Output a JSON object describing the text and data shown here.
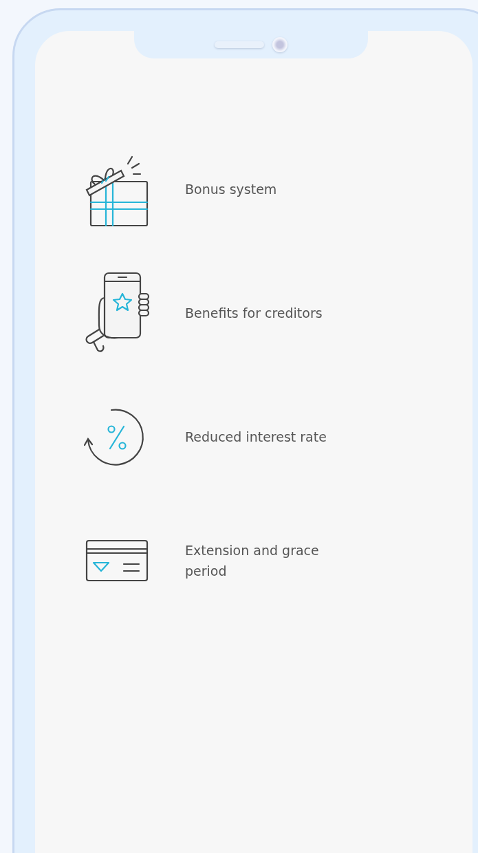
{
  "features": [
    {
      "kind": "gift",
      "label": "Bonus system"
    },
    {
      "kind": "phone",
      "label": "Benefits for creditors"
    },
    {
      "kind": "percent",
      "label": "Reduced interest rate"
    },
    {
      "kind": "card",
      "label": "Extension and grace period"
    }
  ]
}
